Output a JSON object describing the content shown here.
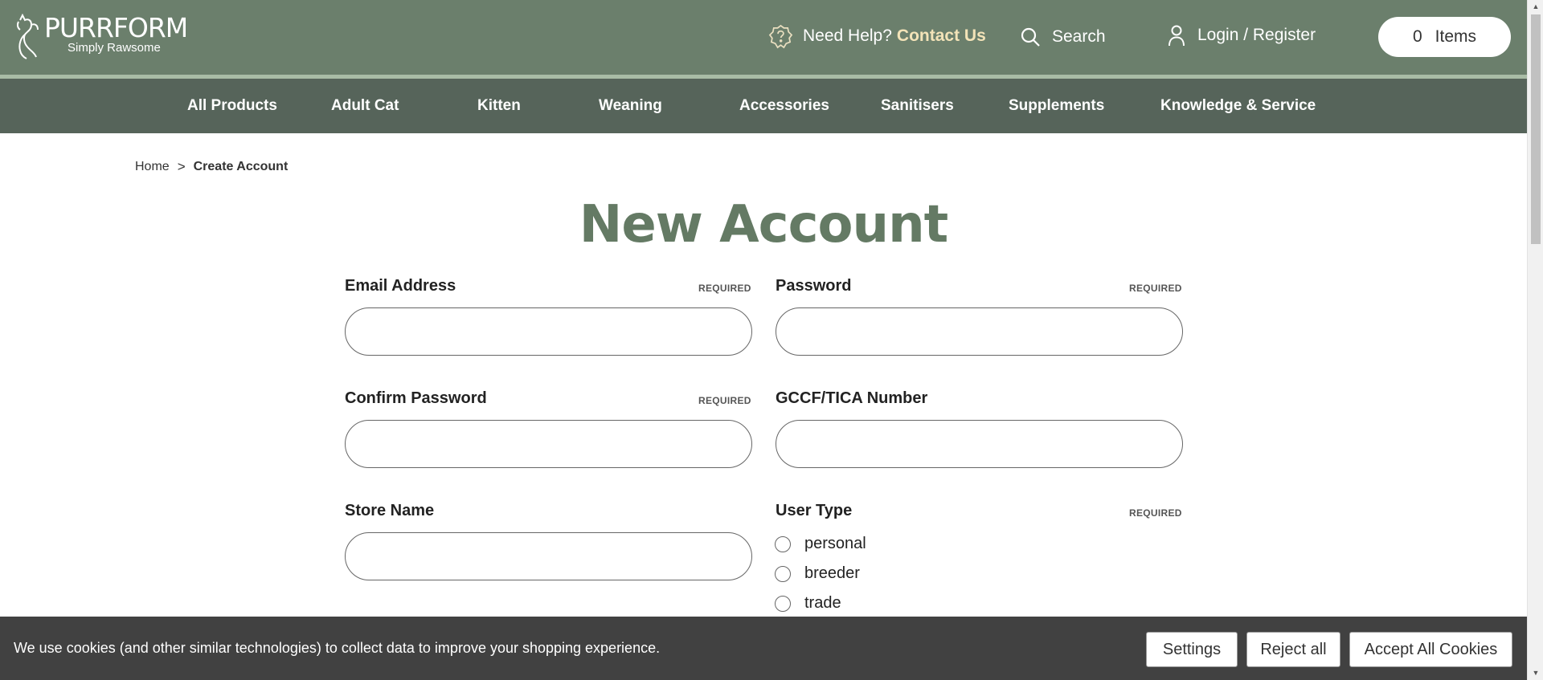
{
  "header": {
    "logo": {
      "name": "PURRFORM",
      "tagline": "Simply Rawsome"
    },
    "help_text": "Need Help?",
    "contact_link": "Contact Us",
    "search_label": "Search",
    "login_label": "Login / Register",
    "cart": {
      "count": "0",
      "label": "Items"
    },
    "icons": {
      "help": "help-badge-icon",
      "search": "search-icon",
      "login": "user-icon"
    }
  },
  "nav": {
    "items": [
      {
        "label": "All Products"
      },
      {
        "label": "Adult Cat"
      },
      {
        "label": "Kitten"
      },
      {
        "label": "Weaning"
      },
      {
        "label": "Accessories"
      },
      {
        "label": "Sanitisers"
      },
      {
        "label": "Supplements"
      },
      {
        "label": "Knowledge & Service"
      }
    ]
  },
  "breadcrumb": {
    "home": "Home",
    "separator": ">",
    "current": "Create Account"
  },
  "page_title": "New Account",
  "form": {
    "email": {
      "label": "Email Address",
      "required": "REQUIRED",
      "value": ""
    },
    "password": {
      "label": "Password",
      "required": "REQUIRED",
      "value": ""
    },
    "confirm_password": {
      "label": "Confirm Password",
      "required": "REQUIRED",
      "value": ""
    },
    "gccf": {
      "label": "GCCF/TICA Number",
      "value": ""
    },
    "store_name": {
      "label": "Store Name",
      "value": ""
    },
    "user_type": {
      "label": "User Type",
      "required": "REQUIRED",
      "options": [
        "personal",
        "breeder",
        "trade"
      ]
    }
  },
  "cookie_bar": {
    "text": "We use cookies (and other similar technologies) to collect data to improve your shopping experience.",
    "settings": "Settings",
    "reject": "Reject all",
    "accept": "Accept All Cookies"
  },
  "colors": {
    "header_bg": "#6b7f6c",
    "nav_bg": "#56645a",
    "title": "#647a64",
    "contact_accent": "#f3e3b8",
    "cookie_bg": "#414141"
  }
}
